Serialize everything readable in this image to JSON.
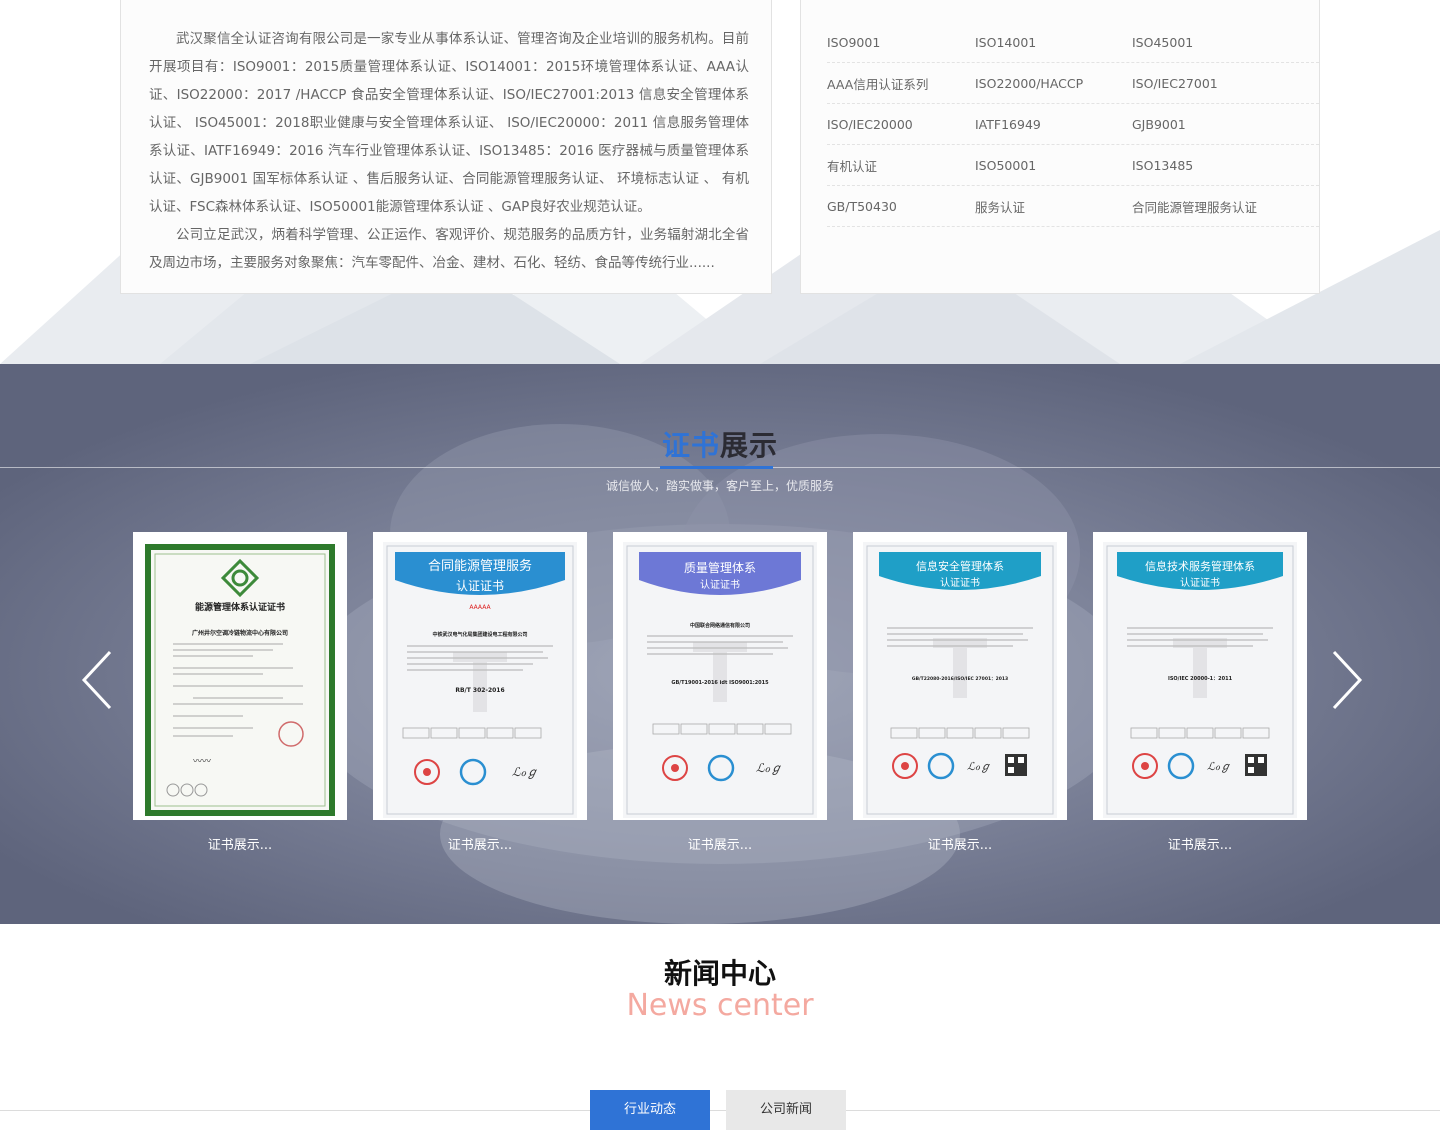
{
  "about": {
    "paragraph1": "武汉聚信全认证咨询有限公司是一家专业从事体系认证、管理咨询及企业培训的服务机构。目前开展项目有：ISO9001：2015质量管理体系认证、ISO14001：2015环境管理体系认证、AAA认证、ISO22000：2017 /HACCP 食品安全管理体系认证、ISO/IEC27001:2013 信息安全管理体系认证、 ISO45001：2018职业健康与安全管理体系认证、 ISO/IEC20000：2011 信息服务管理体系认证、IATF16949：2016 汽车行业管理体系认证、ISO13485：2016 医疗器械与质量管理体系认证、GJB9001 国军标体系认证 、售后服务认证、合同能源管理服务认证、 环境标志认证 、 有机认证、FSC森林体系认证、ISO50001能源管理体系认证 、GAP良好农业规范认证。",
    "paragraph2": "公司立足武汉，炳着科学管理、公正运作、客观评价、规范服务的品质方针，业务辐射湖北全省及周边市场，主要服务对象聚焦：汽车零配件、冶金、建材、石化、轻纺、食品等传统行业......"
  },
  "cert_links": [
    [
      "ISO9001",
      "ISO14001",
      "ISO45001"
    ],
    [
      "AAA信用认证系列",
      "ISO22000/HACCP",
      "ISO/IEC27001"
    ],
    [
      "ISO/IEC20000",
      "IATF16949",
      "GJB9001"
    ],
    [
      "有机认证",
      "ISO50001",
      "ISO13485"
    ],
    [
      "GB/T50430",
      "服务认证",
      "合同能源管理服务认证"
    ]
  ],
  "cert_section": {
    "title_highlight": "证书",
    "title_rest": "展示",
    "subtitle": "诚信做人，踏实做事，客户至上，优质服务",
    "cards": [
      {
        "caption": "证书展示...",
        "header": "能源管理体系认证证书",
        "company": "广州井尔空调冷链物流中心有限公司",
        "style": "green"
      },
      {
        "caption": "证书展示...",
        "header1": "合同能源管理服务",
        "header2": "认证证书",
        "company": "中铁武汉电气化局集团建设电工程有限公司",
        "standard": "RB/T 302-2016",
        "badge": "AAAAA",
        "style": "blue"
      },
      {
        "caption": "证书展示...",
        "header1": "质量管理体系",
        "header2": "认证证书",
        "company": "中国联合网络通信有限公司",
        "standard": "GB/T19001-2016 idt ISO9001:2015",
        "style": "purple"
      },
      {
        "caption": "证书展示...",
        "header1": "信息安全管理体系",
        "header2": "认证证书",
        "company": "",
        "standard": "GB/T22080-2016/ISO/IEC 27001：2013",
        "style": "teal"
      },
      {
        "caption": "证书展示...",
        "header1": "信息技术服务管理体系",
        "header2": "认证证书",
        "company": "",
        "standard": "ISO/IEC 20000-1：2011",
        "style": "teal"
      }
    ]
  },
  "news": {
    "title": "新闻中心",
    "subtitle_en": "News center",
    "tabs": [
      "行业动态",
      "公司新闻"
    ]
  },
  "colors": {
    "accent": "#2f73d6",
    "cert_band": "#6b7189",
    "news_en": "#f4a9a0"
  }
}
